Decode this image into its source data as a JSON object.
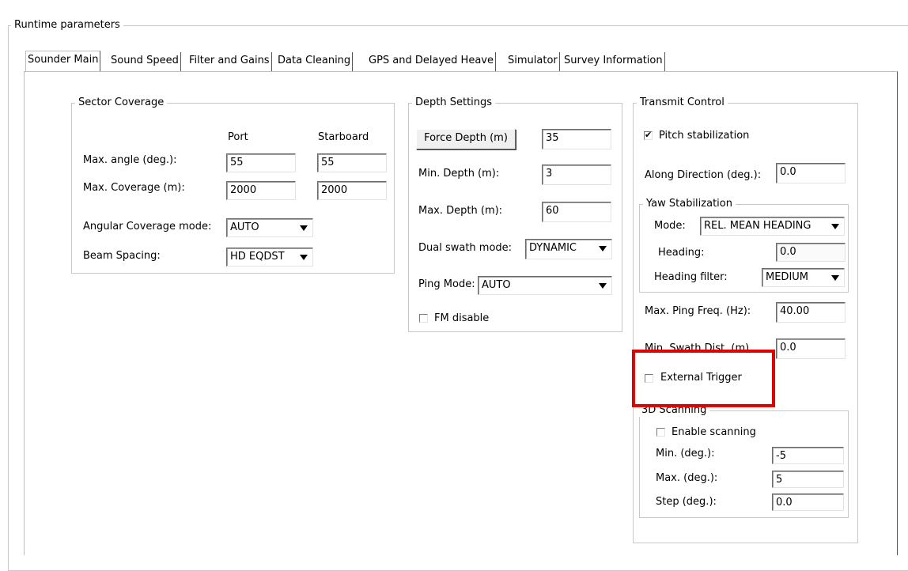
{
  "group_title": "Runtime parameters",
  "tabs": [
    {
      "label": "Sounder Main",
      "active": true
    },
    {
      "label": "Sound Speed"
    },
    {
      "label": "Filter and Gains"
    },
    {
      "label": "Data Cleaning"
    },
    {
      "label": "GPS and Delayed Heave"
    },
    {
      "label": "Simulator"
    },
    {
      "label": "Survey Information"
    }
  ],
  "sector": {
    "title": "Sector Coverage",
    "port_header": "Port",
    "starboard_header": "Starboard",
    "max_angle_label": "Max. angle (deg.):",
    "max_angle_port": "55",
    "max_angle_stbd": "55",
    "max_coverage_label": "Max. Coverage (m):",
    "max_coverage_port": "2000",
    "max_coverage_stbd": "2000",
    "angular_mode_label": "Angular Coverage mode:",
    "angular_mode_value": "AUTO",
    "beam_spacing_label": "Beam Spacing:",
    "beam_spacing_value": "HD EQDST"
  },
  "depth": {
    "title": "Depth Settings",
    "force_depth_label": "Force Depth (m)",
    "force_depth_value": "35",
    "min_depth_label": "Min. Depth (m):",
    "min_depth_value": "3",
    "max_depth_label": "Max. Depth (m):",
    "max_depth_value": "60",
    "dual_swath_label": "Dual swath mode:",
    "dual_swath_value": "DYNAMIC",
    "ping_mode_label": "Ping Mode:",
    "ping_mode_value": "AUTO",
    "fm_disable_label": "FM disable",
    "fm_disable_checked": false
  },
  "transmit": {
    "title": "Transmit Control",
    "pitch_label": "Pitch stabilization",
    "pitch_checked": true,
    "along_label": "Along Direction (deg.):",
    "along_value": "0.0",
    "yaw": {
      "title": "Yaw Stabilization",
      "mode_label": "Mode:",
      "mode_value": "REL. MEAN HEADING",
      "heading_label": "Heading:",
      "heading_value": "0.0",
      "filter_label": "Heading filter:",
      "filter_value": "MEDIUM"
    },
    "max_ping_label": "Max. Ping Freq. (Hz):",
    "max_ping_value": "40.00",
    "min_swath_label": "Min. Swath Dist. (m)",
    "min_swath_value": "0.0",
    "external_trigger_label": "External Trigger",
    "external_trigger_checked": false,
    "scanning": {
      "title": "3D Scanning",
      "enable_label": "Enable scanning",
      "enable_checked": false,
      "min_label": "Min. (deg.):",
      "min_value": "-5",
      "max_label": "Max. (deg.):",
      "max_value": "5",
      "step_label": "Step (deg.):",
      "step_value": "0.0"
    }
  },
  "highlight_color": "#e00000"
}
